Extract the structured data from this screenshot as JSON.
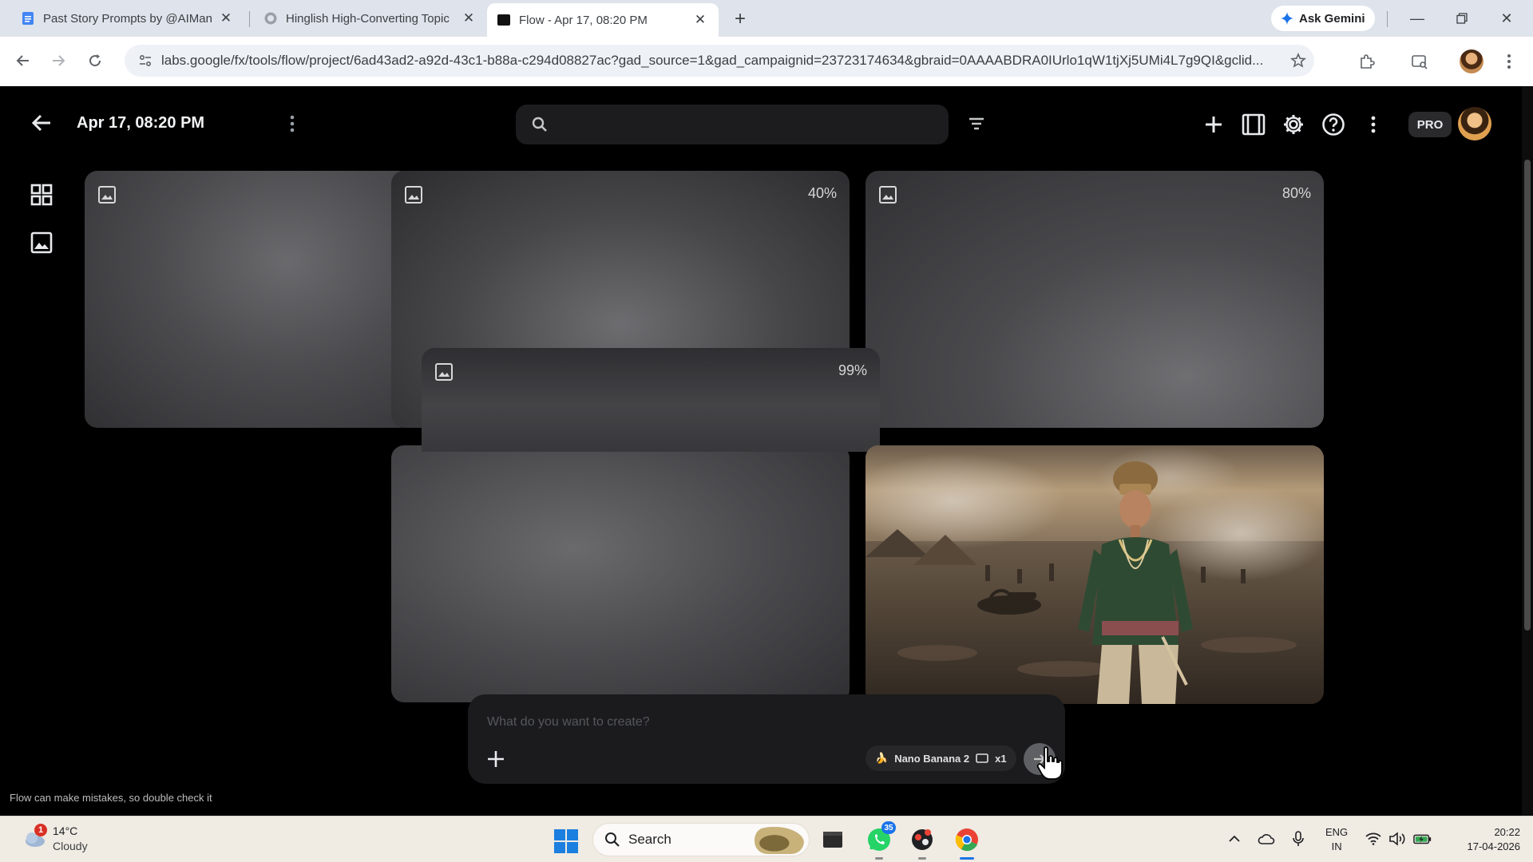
{
  "browser": {
    "tabs": [
      {
        "title": "Past Story Prompts by @AIMan",
        "icon": "docs-icon",
        "active": false
      },
      {
        "title": "Hinglish High-Converting Topic",
        "icon": "globe-icon",
        "active": false
      },
      {
        "title": "Flow - Apr 17, 08:20 PM",
        "icon": "flow-icon",
        "active": true
      }
    ],
    "ask_gemini": "Ask Gemini",
    "url": "labs.google/fx/tools/flow/project/6ad43ad2-a92d-43c1-b88a-c294d08827ac?gad_source=1&gad_campaignid=23723174634&gbraid=0AAAABDRA0IUrlo1qW1tjXj5UMi4L7g9QI&gclid..."
  },
  "app": {
    "title": "Apr 17, 08:20 PM",
    "search": {
      "placeholder": ""
    },
    "pro_label": "PRO",
    "cards": [
      {
        "id": "card-1",
        "progress_label": "",
        "state": "loading"
      },
      {
        "id": "card-2",
        "progress_label": "40%",
        "progress": 0.4,
        "state": "generating"
      },
      {
        "id": "card-3",
        "progress_label": "80%",
        "progress": 0.8,
        "state": "generating"
      },
      {
        "id": "card-4",
        "progress_label": "99%",
        "progress": 0.99,
        "state": "generating"
      },
      {
        "id": "card-5",
        "progress_label": "",
        "state": "loading"
      },
      {
        "id": "card-6",
        "state": "complete",
        "description": "generated-image"
      }
    ],
    "prompt": {
      "placeholder": "What do you want to create?",
      "model": "Nano Banana 2",
      "count": "x1"
    },
    "disclaimer": "Flow can make mistakes, so double check it"
  },
  "taskbar": {
    "weather_temp": "14°C",
    "weather_desc": "Cloudy",
    "weather_badge": "1",
    "search_label": "Search",
    "whatsapp_badge": "35",
    "lang_line1": "ENG",
    "lang_line2": "IN",
    "time": "20:22",
    "date": "17-04-2026"
  },
  "colors": {
    "app_background": "#000000",
    "card_placeholder": "#4c4c4f",
    "prompt_panel": "#1b1b1d",
    "taskbar": "#f0ebe3"
  }
}
